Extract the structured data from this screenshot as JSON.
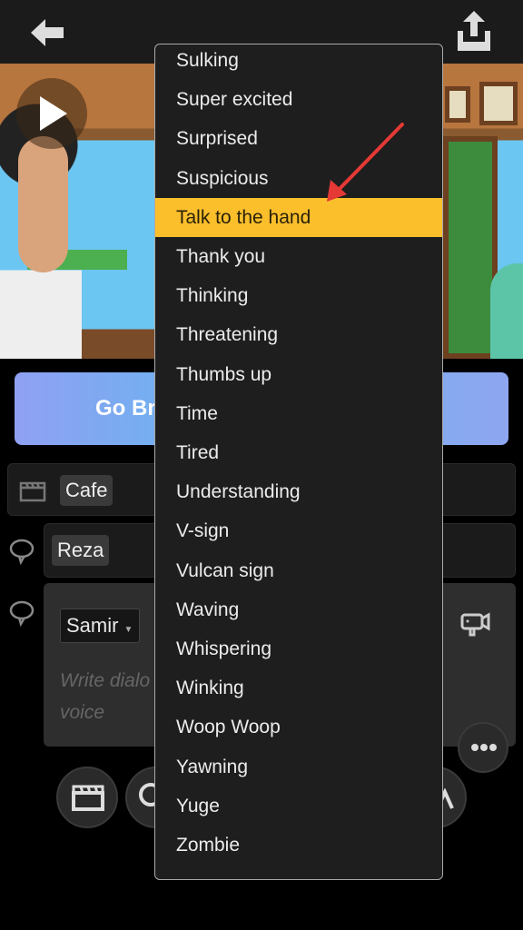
{
  "header": {
    "back_icon": "arrow-left-icon",
    "share_icon": "share-upload-icon"
  },
  "preview": {
    "play_icon": "play-icon"
  },
  "go_button": {
    "label": "Go Br"
  },
  "scene_row": {
    "icon": "clapperboard-icon",
    "location": "Cafe"
  },
  "dialog_row_1": {
    "icon": "speech-bubble-icon",
    "character": "Reza"
  },
  "dialog_row_2": {
    "icon": "speech-bubble-icon",
    "character": "Samir",
    "placeholder_line1": "Write dialo",
    "placeholder_line2": "voice",
    "camera_icon": "camera-icon"
  },
  "more_button": {
    "icon": "more-dots-icon"
  },
  "bottom_toolbar": {
    "icons": [
      "clapperboard-icon",
      "speech-bubble-icon",
      "person-icon"
    ]
  },
  "highlight_color": "#fbbf2c",
  "annotation": {
    "arrow_color": "#e53935"
  },
  "menu": {
    "selected": "Talk to the hand",
    "items": [
      "Sulking",
      "Super excited",
      "Surprised",
      "Suspicious",
      "Talk to the hand",
      "Thank you",
      "Thinking",
      "Threatening",
      "Thumbs up",
      "Time",
      "Tired",
      "Understanding",
      "V-sign",
      "Vulcan sign",
      "Waving",
      "Whispering",
      "Winking",
      "Woop Woop",
      "Yawning",
      "Yuge",
      "Zombie"
    ]
  }
}
